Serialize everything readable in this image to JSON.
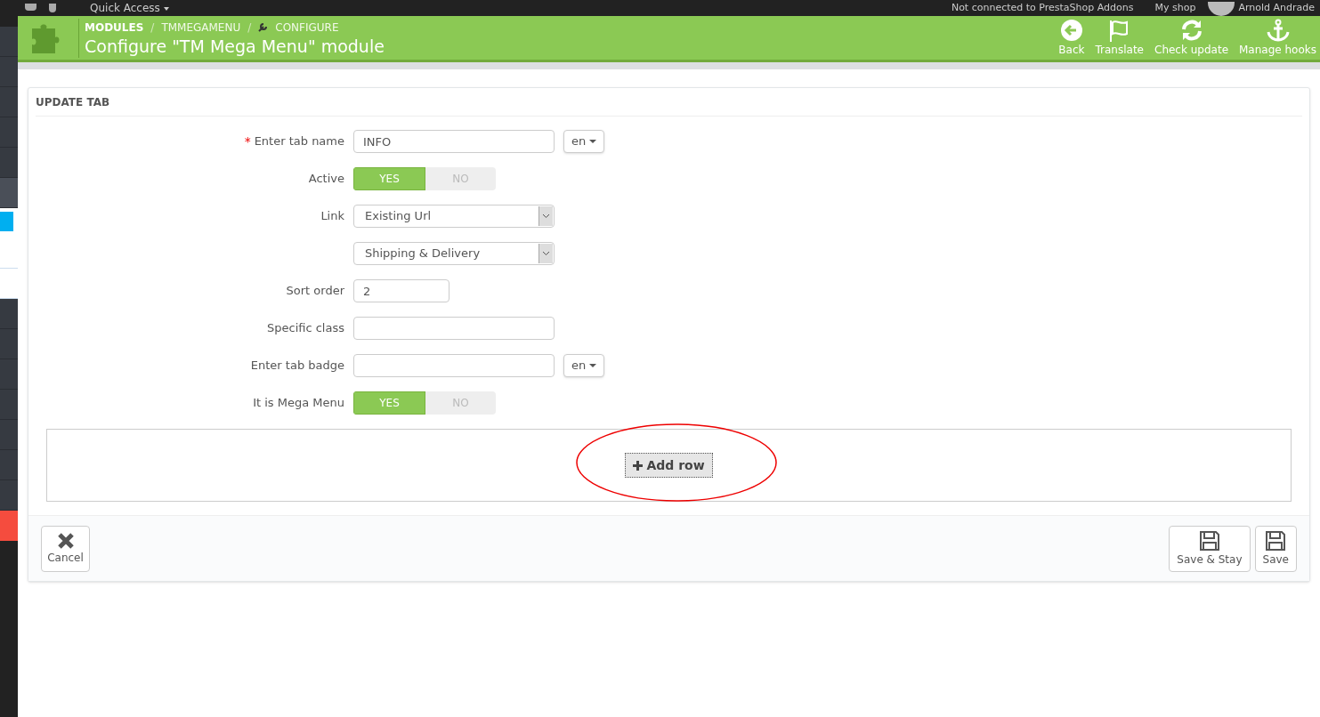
{
  "top_bar": {
    "quick_access": "Quick Access",
    "addons_status": "Not connected to PrestaShop Addons",
    "shop": "My shop",
    "user": "Arnold Andrade"
  },
  "sidebar": {
    "items": [
      {
        "kind": "plain"
      },
      {
        "kind": "plain"
      },
      {
        "kind": "plain"
      },
      {
        "kind": "plain"
      },
      {
        "kind": "plain"
      },
      {
        "kind": "active"
      },
      {
        "kind": "highlight"
      },
      {
        "kind": "light"
      },
      {
        "kind": "light"
      },
      {
        "kind": "plain"
      },
      {
        "kind": "plain"
      },
      {
        "kind": "plain"
      },
      {
        "kind": "plain"
      },
      {
        "kind": "plain"
      },
      {
        "kind": "plain"
      },
      {
        "kind": "plain"
      },
      {
        "kind": "alert"
      }
    ]
  },
  "header": {
    "breadcrumb": [
      "MODULES",
      "TMMEGAMENU",
      "CONFIGURE"
    ],
    "separator": "/",
    "title": "Configure \"TM Mega Menu\" module",
    "toolbar": [
      {
        "kind": "back",
        "label": "Back"
      },
      {
        "kind": "flag",
        "label": "Translate"
      },
      {
        "kind": "refresh",
        "label": "Check update"
      },
      {
        "kind": "anchor",
        "label": "Manage hooks"
      }
    ]
  },
  "panel": {
    "title": "UPDATE TAB",
    "fields": [
      {
        "kind": "text",
        "label": "Enter tab name",
        "required_mark": "*",
        "value": "INFO",
        "lang": "en"
      },
      {
        "kind": "switch",
        "label": "Active",
        "options": [
          {
            "label": "YES",
            "selected": true
          },
          {
            "label": "NO",
            "selected": false
          }
        ]
      },
      {
        "kind": "select",
        "label": "Link",
        "value": "Existing Url"
      },
      {
        "kind": "select",
        "value": "Shipping & Delivery"
      },
      {
        "kind": "number",
        "label": "Sort order",
        "value": "2"
      },
      {
        "kind": "text",
        "label": "Specific class"
      },
      {
        "kind": "text",
        "label": "Enter tab badge",
        "lang": "en"
      },
      {
        "kind": "switch",
        "label": "It is Mega Menu",
        "options": [
          {
            "label": "YES",
            "selected": true
          },
          {
            "label": "NO",
            "selected": false
          }
        ]
      }
    ],
    "add_row": "Add row",
    "footer": {
      "cancel": "Cancel",
      "save_stay": "Save & Stay",
      "save": "Save"
    }
  }
}
